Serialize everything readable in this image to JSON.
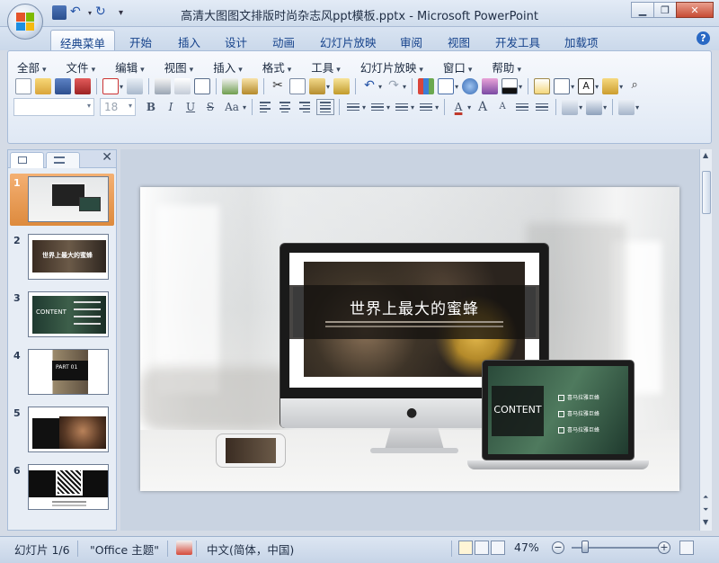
{
  "window": {
    "title": "高清大图图文排版时尚杂志风ppt模板.pptx - Microsoft PowerPoint",
    "buttons": [
      "minimize",
      "restore",
      "close"
    ]
  },
  "ribbon_tabs": [
    {
      "label": "经典菜单",
      "active": true
    },
    {
      "label": "开始"
    },
    {
      "label": "插入"
    },
    {
      "label": "设计"
    },
    {
      "label": "动画"
    },
    {
      "label": "幻灯片放映"
    },
    {
      "label": "审阅"
    },
    {
      "label": "视图"
    },
    {
      "label": "开发工具"
    },
    {
      "label": "加载项"
    }
  ],
  "menu": [
    {
      "label": "全部"
    },
    {
      "label": "文件"
    },
    {
      "label": "编辑"
    },
    {
      "label": "视图"
    },
    {
      "label": "插入"
    },
    {
      "label": "格式"
    },
    {
      "label": "工具"
    },
    {
      "label": "幻灯片放映"
    },
    {
      "label": "窗口"
    },
    {
      "label": "帮助"
    }
  ],
  "format_toolbar": {
    "font_size": "18",
    "bold": "B",
    "italic": "I",
    "underline": "U",
    "strike": "S",
    "change_case": "Aa",
    "font_color": "A",
    "grow": "A",
    "shrink": "A",
    "text_box": "A"
  },
  "slides": [
    {
      "number": "1",
      "selected": true
    },
    {
      "number": "2",
      "thumb_text": "世界上最大的蜜蜂"
    },
    {
      "number": "3",
      "thumb_text": "CONTENT"
    },
    {
      "number": "4",
      "thumb_text": "PART 01"
    },
    {
      "number": "5"
    },
    {
      "number": "6"
    }
  ],
  "current_slide": {
    "monitor_title": "世界上最大的蜜蜂",
    "laptop_title": "CONTENT",
    "laptop_items": [
      "喜马拉雅巨蜂",
      "喜马拉雅巨蜂",
      "喜马拉雅巨蜂"
    ]
  },
  "status": {
    "slide_counter": "幻灯片 1/6",
    "theme": "\"Office 主题\"",
    "language": "中文(简体，中国)",
    "zoom": "47%",
    "zoom_fraction": 0.47
  },
  "colors": {
    "selected_thumb": "#dd8a3d",
    "tab_text": "#15428b",
    "close_button": "#c74b33"
  }
}
